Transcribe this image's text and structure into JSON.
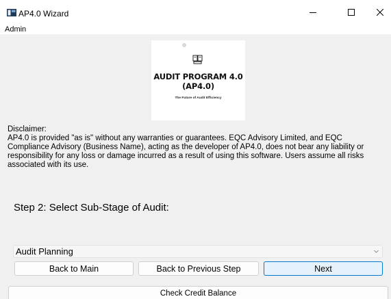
{
  "window": {
    "title": "AP4.0 Wizard",
    "controls": {
      "minimize": "—",
      "maximize": "☐",
      "close": "✕"
    }
  },
  "menu": {
    "items": [
      "Admin"
    ]
  },
  "logo": {
    "title_line1": "AUDIT PROGRAM 4.0",
    "title_line2": "(AP4.0)",
    "tagline": "The Future of Audit Efficiency"
  },
  "disclaimer": {
    "title": "Disclaimer:",
    "body": "AP4.0 is provided \"as is\" without any warranties or guarantees. EQC Advisory Limited, and EQC Compliance Advisory (Business Name), acting as the developer of AP4.0, does not bear any liability or responsibility for any loss or damage incurred as a result of using this software. Users assume all risks associated with its use."
  },
  "step": {
    "label": "Step 2: Select Sub-Stage of Audit:"
  },
  "substage_select": {
    "selected": "Audit Planning"
  },
  "buttons": {
    "back_main": "Back to Main",
    "back_prev": "Back to Previous Step",
    "next": "Next",
    "credit": "Check Credit Balance"
  },
  "colors": {
    "window_bg": "#f0f0f0",
    "titlebar_bg": "#ffffff",
    "focus_button_bg": "#e5f1fb",
    "focus_button_border": "#0078d4"
  }
}
